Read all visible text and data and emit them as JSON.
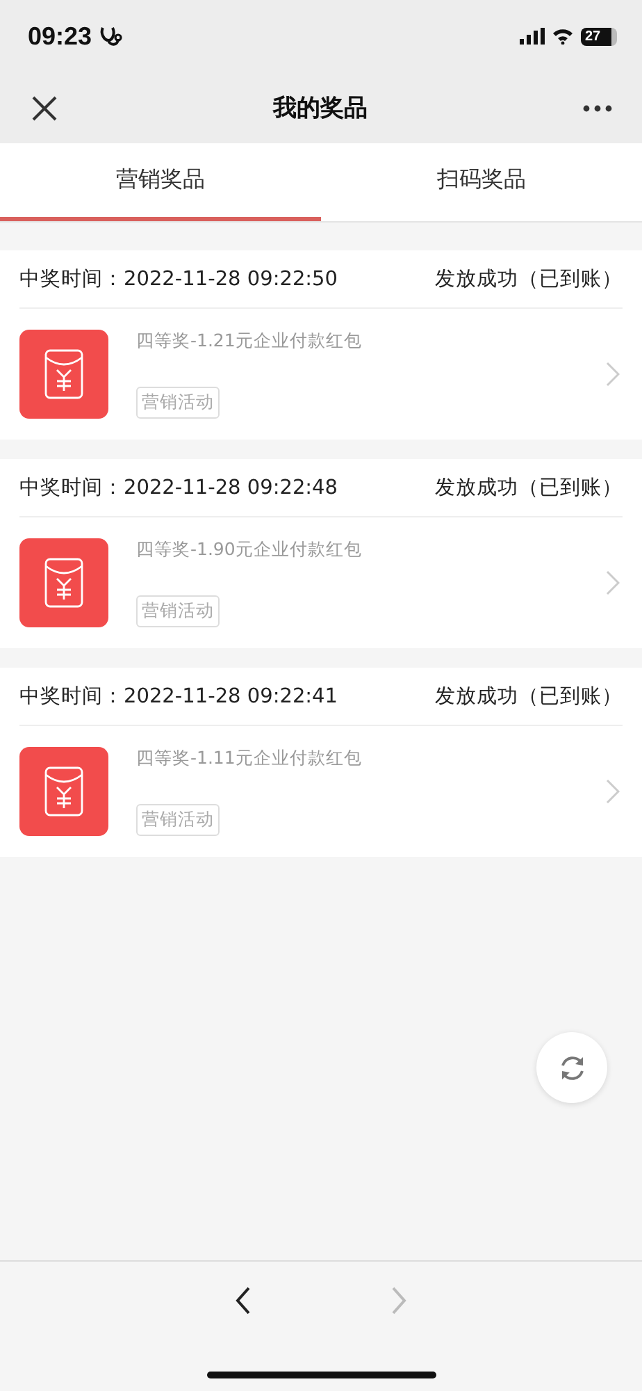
{
  "status_bar": {
    "time": "09:23",
    "battery": "27"
  },
  "nav": {
    "title": "我的奖品"
  },
  "tabs": [
    {
      "label": "营销奖品",
      "selected": true
    },
    {
      "label": "扫码奖品",
      "selected": false
    }
  ],
  "prizes": [
    {
      "time_label": "中奖时间：",
      "time": "2022-11-28 09:22:50",
      "status": "发放成功（已到账）",
      "name": "四等奖-1.21元企业付款红包",
      "tag": "营销活动"
    },
    {
      "time_label": "中奖时间：",
      "time": "2022-11-28 09:22:48",
      "status": "发放成功（已到账）",
      "name": "四等奖-1.90元企业付款红包",
      "tag": "营销活动"
    },
    {
      "time_label": "中奖时间：",
      "time": "2022-11-28 09:22:41",
      "status": "发放成功（已到账）",
      "name": "四等奖-1.11元企业付款红包",
      "tag": "营销活动"
    }
  ]
}
